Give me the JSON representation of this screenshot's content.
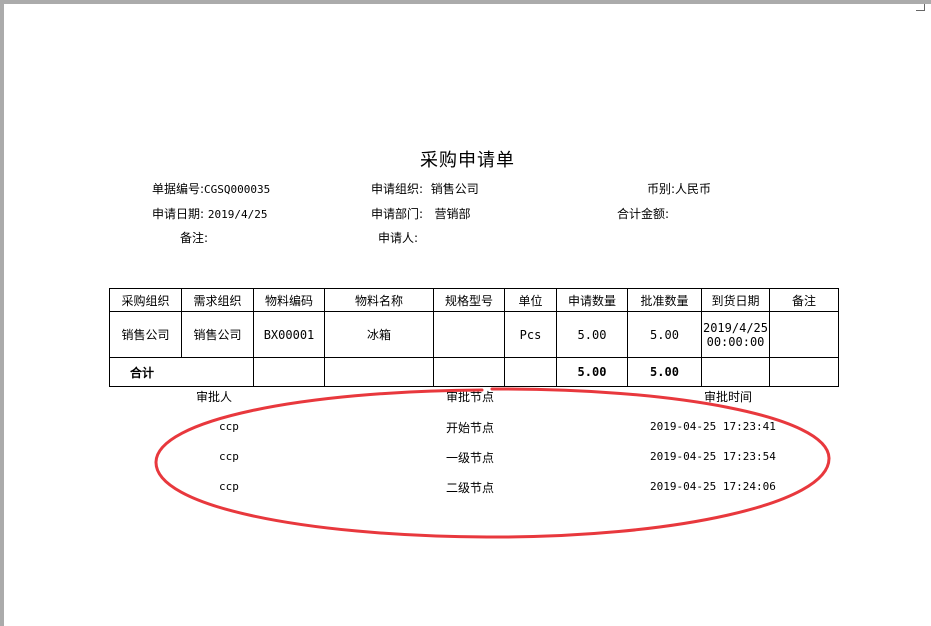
{
  "title": "采购申请单",
  "header": {
    "doc_no_label": "单据编号:",
    "doc_no": "CGSQ000035",
    "req_org_label": "申请组织:",
    "req_org": "销售公司",
    "currency_label": "币别:",
    "currency": "人民币",
    "req_date_label": "申请日期:",
    "req_date": "2019/4/25",
    "req_dept_label": "申请部门:",
    "req_dept": "营销部",
    "total_amount_label": "合计金额:",
    "remark_label": "备注:",
    "applicant_label": "申请人:"
  },
  "table": {
    "columns": [
      "采购组织",
      "需求组织",
      "物料编码",
      "物料名称",
      "规格型号",
      "单位",
      "申请数量",
      "批准数量",
      "到货日期",
      "备注"
    ],
    "row": {
      "purchase_org": "销售公司",
      "demand_org": "销售公司",
      "material_code": "BX00001",
      "material_name": "冰箱",
      "spec": "",
      "unit": "Pcs",
      "req_qty": "5.00",
      "approved_qty": "5.00",
      "arrival_date_1": "2019/4/25",
      "arrival_date_2": "00:00:00",
      "remark": ""
    },
    "total": {
      "label": "合计",
      "req_qty": "5.00",
      "approved_qty": "5.00"
    }
  },
  "approval": {
    "headers": {
      "approver": "审批人",
      "node": "审批节点",
      "time": "审批时间"
    },
    "rows": [
      {
        "approver": "ccp",
        "node": "开始节点",
        "time": "2019-04-25 17:23:41"
      },
      {
        "approver": "ccp",
        "node": "一级节点",
        "time": "2019-04-25 17:23:54"
      },
      {
        "approver": "ccp",
        "node": "二级节点",
        "time": "2019-04-25 17:24:06"
      }
    ]
  },
  "annotation_color": "#e8383d"
}
